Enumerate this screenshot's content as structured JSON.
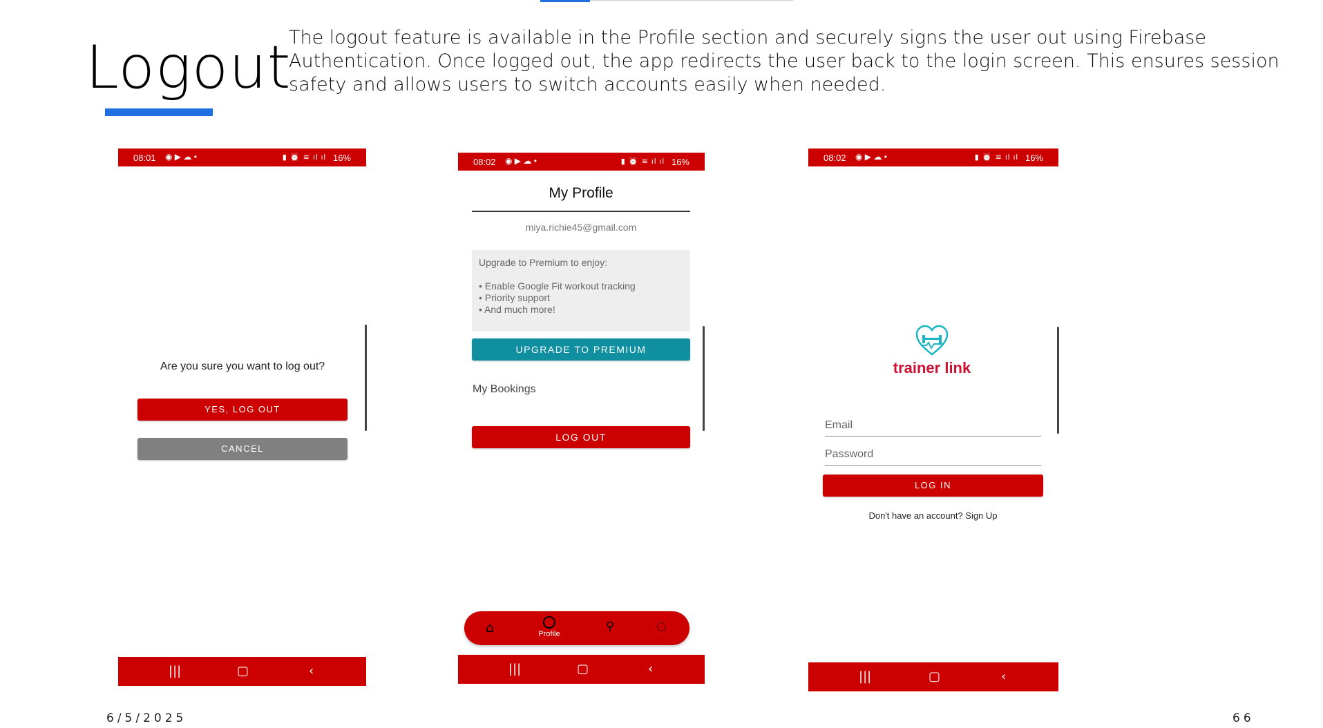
{
  "slide": {
    "title": "Logout",
    "description": "The logout feature is available in the Profile section and securely signs the user out using Firebase Authentication. Once logged out, the app redirects the user back to the login screen. This ensures session safety and allows users to switch accounts easily when needed.",
    "date": "6/5/2025",
    "page_number": "66",
    "accent_color": "#1f6fe0"
  },
  "phone1": {
    "status": {
      "time": "08:01",
      "battery": "16%"
    },
    "dialog_text": "Are you sure you want to log out?",
    "confirm_label": "YES, LOG OUT",
    "cancel_label": "CANCEL"
  },
  "phone2": {
    "status": {
      "time": "08:02",
      "battery": "16%"
    },
    "header": "My Profile",
    "email": "miya.richie45@gmail.com",
    "premium_box": {
      "heading": "Upgrade to Premium to enjoy:",
      "items": [
        "• Enable Google Fit workout tracking",
        "• Priority support",
        "• And much more!"
      ]
    },
    "upgrade_label": "UPGRADE TO PREMIUM",
    "bookings_label": "My Bookings",
    "logout_label": "LOG OUT",
    "bottom_nav": {
      "profile_label": "Profile"
    }
  },
  "phone3": {
    "status": {
      "time": "08:02",
      "battery": "16%"
    },
    "brand": "trainer link",
    "email_placeholder": "Email",
    "password_placeholder": "Password",
    "login_label": "LOG IN",
    "signup_text": "Don't have an account? Sign Up"
  },
  "colors": {
    "app_red": "#cc0000",
    "teal": "#0f8fa0",
    "logo_teal": "#19b5c2"
  }
}
